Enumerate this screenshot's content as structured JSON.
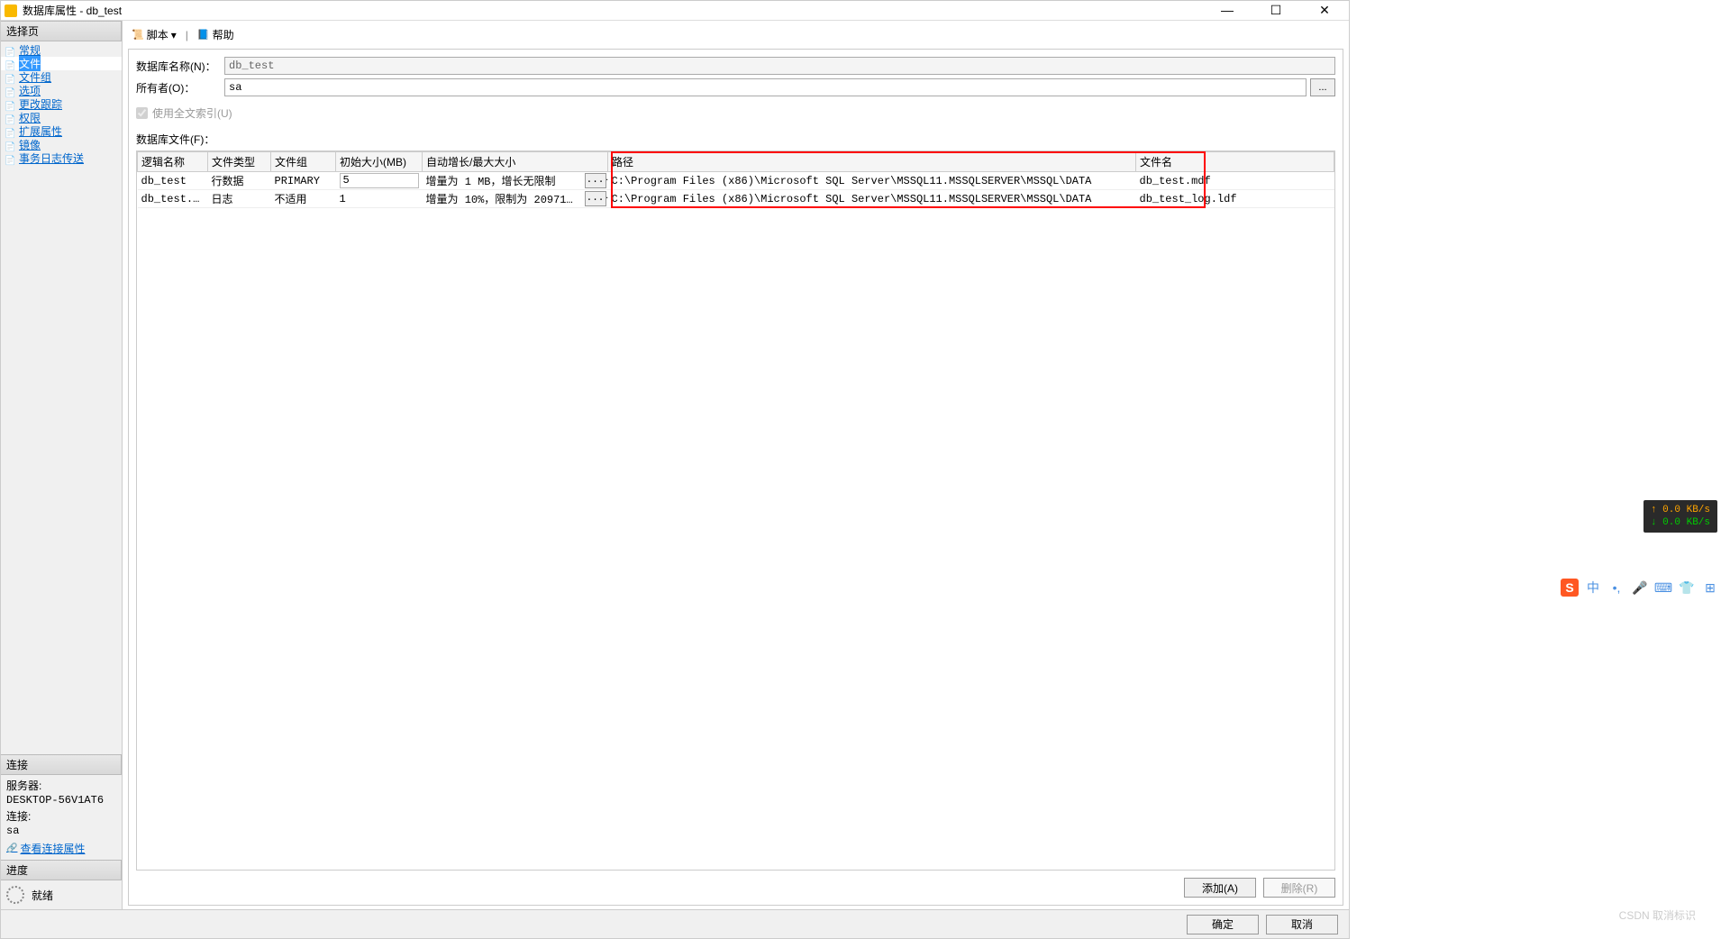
{
  "window": {
    "title": "数据库属性 - db_test"
  },
  "sidebar": {
    "select_header": "选择页",
    "items": [
      {
        "label": "常规"
      },
      {
        "label": "文件",
        "selected": true
      },
      {
        "label": "文件组"
      },
      {
        "label": "选项"
      },
      {
        "label": "更改跟踪"
      },
      {
        "label": "权限"
      },
      {
        "label": "扩展属性"
      },
      {
        "label": "镜像"
      },
      {
        "label": "事务日志传送"
      }
    ],
    "connection_header": "连接",
    "connection": {
      "server_label": "服务器:",
      "server_value": "DESKTOP-56V1AT6",
      "conn_label": "连接:",
      "conn_value": "sa",
      "view_link": "查看连接属性"
    },
    "progress_header": "进度",
    "progress_status": "就绪"
  },
  "toolbar": {
    "script": "脚本",
    "help": "帮助"
  },
  "form": {
    "db_name_label": "数据库名称(N)：",
    "db_name_value": "db_test",
    "owner_label": "所有者(O)：",
    "owner_value": "sa",
    "browse": "...",
    "fulltext_label": "使用全文索引(U)",
    "files_section": "数据库文件(F)："
  },
  "table": {
    "headers": {
      "logical_name": "逻辑名称",
      "file_type": "文件类型",
      "file_group": "文件组",
      "init_size": "初始大小(MB)",
      "autogrow": "自动增长/最大大小",
      "path": "路径",
      "filename": "文件名"
    },
    "rows": [
      {
        "name": "db_test",
        "type": "行数据",
        "group": "PRIMARY",
        "size": "5",
        "size_editable": true,
        "grow": "增量为 1 MB，增长无限制",
        "path": "C:\\Program Files (x86)\\Microsoft SQL Server\\MSSQL11.MSSQLSERVER\\MSSQL\\DATA",
        "fname": "db_test.mdf"
      },
      {
        "name": "db_test...",
        "type": "日志",
        "group": "不适用",
        "size": "1",
        "size_editable": false,
        "grow": "增量为 10%，限制为 20971...",
        "path": "C:\\Program Files (x86)\\Microsoft SQL Server\\MSSQL11.MSSQLSERVER\\MSSQL\\DATA",
        "fname": "db_test_log.ldf"
      }
    ]
  },
  "buttons": {
    "add": "添加(A)",
    "remove": "删除(R)",
    "ok": "确定",
    "cancel": "取消"
  },
  "overlay": {
    "up": "↑ 0.0 KB/s",
    "down": "↓ 0.0 KB/s"
  },
  "ime": {
    "s": "S",
    "zh": "中"
  },
  "watermark": "CSDN 取消标识"
}
